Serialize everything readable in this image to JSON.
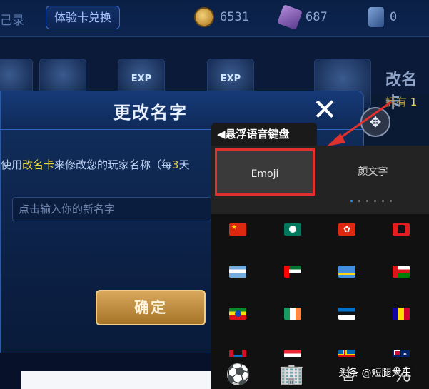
{
  "topbar": {
    "record_fragment": "己录",
    "trial_button": "体验卡兑换",
    "gold_value": "6531",
    "gem_value": "687",
    "card_value": "0"
  },
  "background": {
    "exp_label": "EXP",
    "item_title": "改名卡",
    "owned_label": "拥有",
    "owned_count": "1"
  },
  "dialog": {
    "title": "更改名字",
    "close_symbol": "✕",
    "desc_prefix": "使用",
    "desc_highlight": "改名卡",
    "desc_middle": "来修改您的玩家名称（每",
    "desc_number": "3",
    "desc_suffix": "天",
    "input_placeholder": "点击输入你的新名字",
    "confirm_label": "确定"
  },
  "keyboard": {
    "header": "◀悬浮语音键盘",
    "tabs": [
      "Emoji",
      "颜文字"
    ],
    "active_tab": "Emoji",
    "page_count": 6,
    "active_page": 1,
    "flags": [
      "china",
      "macau",
      "hong-kong",
      "albania",
      "argentina",
      "uae",
      "aruba",
      "oman",
      "ethiopia",
      "ireland",
      "estonia",
      "andorra",
      "antigua-barbuda",
      "austria",
      "aland",
      "australia"
    ],
    "bottom_icons": [
      "soccer-ball-icon",
      "building-icon",
      "trophy-icon",
      "symbols-icon"
    ]
  },
  "watermark": "头条 @短腿大王",
  "colors": {
    "accent_red": "#e0312f",
    "gold_button": "#c48f40",
    "highlight_yellow": "#e8d64a"
  }
}
